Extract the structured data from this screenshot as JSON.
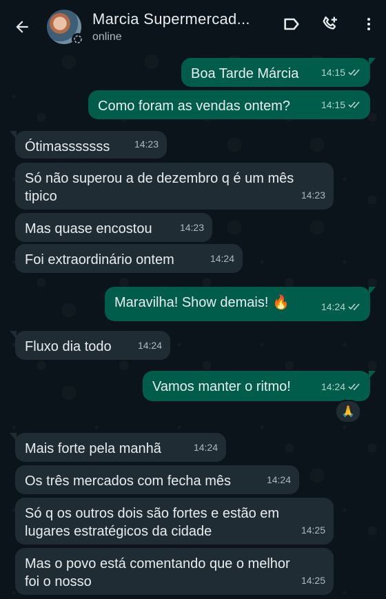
{
  "header": {
    "contact_name": "Marcia Supermercad...",
    "status": "online"
  },
  "icons": {
    "back": "arrow-left-icon",
    "label": "label-tag-icon",
    "add_call": "call-add-icon",
    "menu": "more-vertical-icon"
  },
  "colors": {
    "background": "#0b141a",
    "incoming_bubble": "#202c33",
    "outgoing_bubble": "#005c4b",
    "read_ticks": "#b7d4cc"
  },
  "messages": [
    {
      "dir": "out",
      "text": "Boa Tarde Márcia",
      "time": "14:15",
      "read": true
    },
    {
      "dir": "out",
      "text": "Como foram as vendas ontem?",
      "time": "14:15",
      "read": true
    },
    {
      "dir": "in",
      "text": "Ótimasssssss",
      "time": "14:23"
    },
    {
      "dir": "in",
      "text": "Só não superou a de dezembro q é um mês\ntipico",
      "time": "14:23"
    },
    {
      "dir": "in",
      "text": "Mas quase encostou",
      "time": "14:23"
    },
    {
      "dir": "in",
      "text": "Foi extraordinário ontem",
      "time": "14:24"
    },
    {
      "dir": "out",
      "text": "Maravilha! Show demais! 🔥",
      "time": "14:24",
      "read": true
    },
    {
      "dir": "in",
      "text": "Fluxo dia todo",
      "time": "14:24"
    },
    {
      "dir": "out",
      "text": "Vamos manter o ritmo!",
      "time": "14:24",
      "read": true,
      "reaction": "🙏"
    },
    {
      "dir": "in",
      "text": "Mais forte pela manhã",
      "time": "14:24"
    },
    {
      "dir": "in",
      "text": "Os três mercados com fecha mês",
      "time": "14:24"
    },
    {
      "dir": "in",
      "text": "Só q os outros dois são fortes e estão em\nlugares estratégicos da cidade",
      "time": "14:25"
    },
    {
      "dir": "in",
      "text": "Mas o povo está comentando que o melhor\nfoi o nosso",
      "time": "14:25"
    }
  ]
}
